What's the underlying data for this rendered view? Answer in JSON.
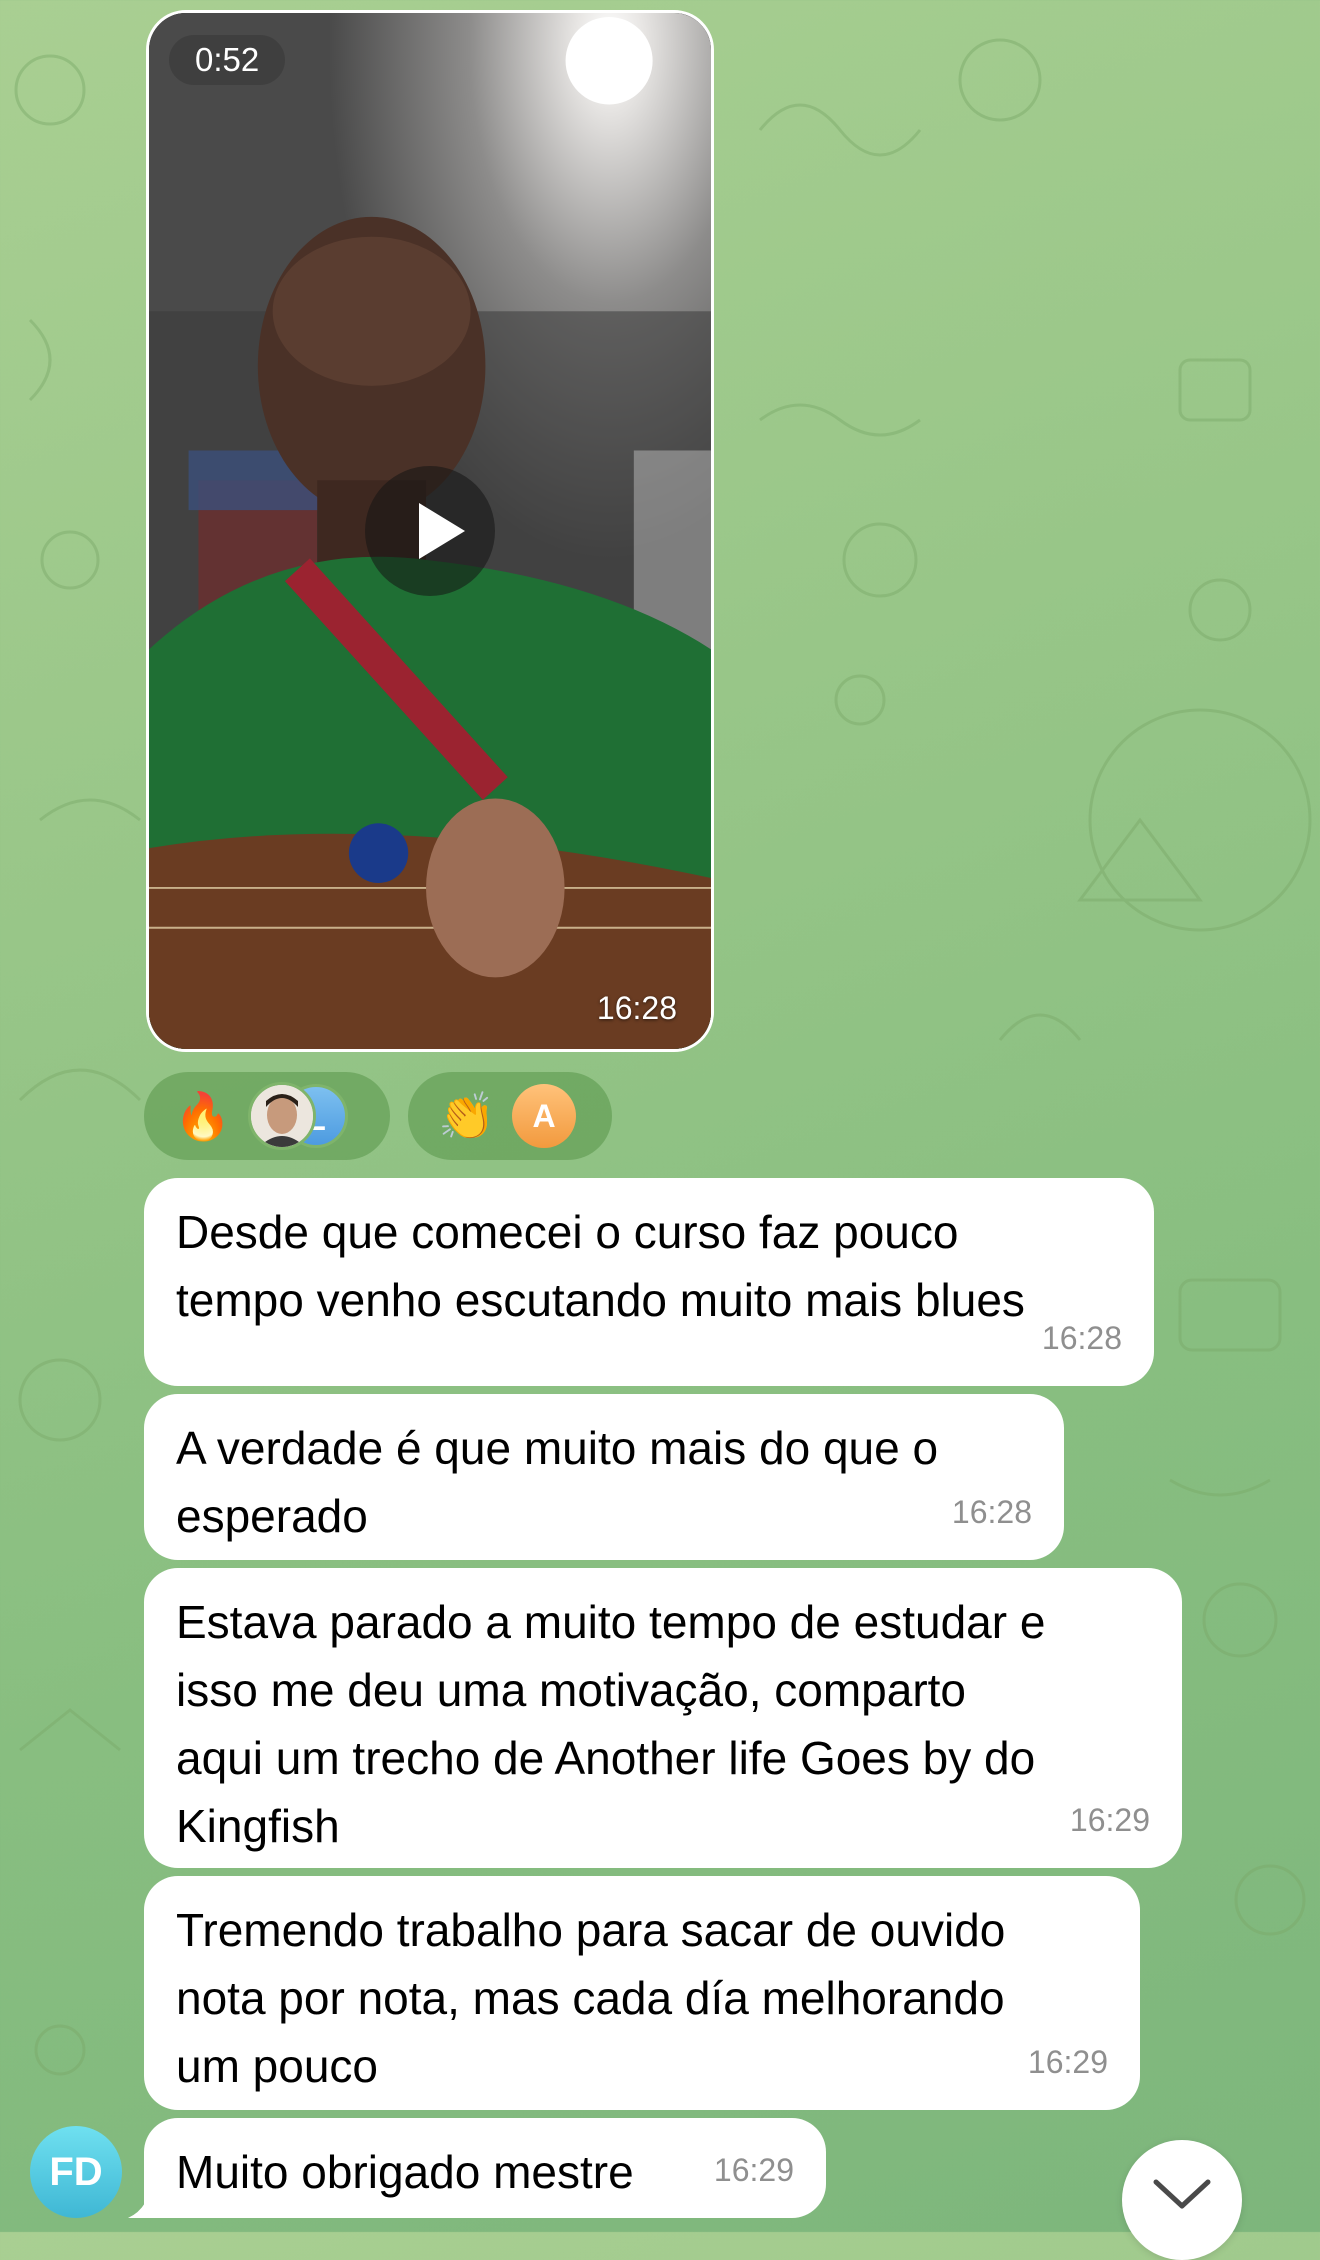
{
  "video": {
    "duration": "0:52",
    "time": "16:28",
    "icons": {
      "play": "play-icon"
    }
  },
  "reactions": [
    {
      "emoji": "🔥",
      "avatars": [
        "photo",
        "L"
      ]
    },
    {
      "emoji": "👏",
      "avatars": [
        "A"
      ]
    }
  ],
  "messages": [
    {
      "text": "Desde que comecei o curso faz pouco\ntempo venho escutando muito mais blues",
      "time": "16:28"
    },
    {
      "text": "A verdade é que muito mais do que o\nesperado",
      "time": "16:28"
    },
    {
      "text": "Estava parado a muito tempo de estudar e\nisso me deu uma motivação, comparto\naqui um trecho de Another life Goes by do\nKingfish",
      "time": "16:29"
    },
    {
      "text": "Tremendo trabalho para sacar de ouvido\nnota por nota, mas cada día melhorando\num pouco",
      "time": "16:29"
    },
    {
      "text": "Muito obrigado mestre",
      "time": "16:29"
    }
  ],
  "sender": {
    "initials": "FD"
  },
  "colors": {
    "bubble": "#ffffff",
    "time": "#8f8f8f",
    "wallpaper": "#98c688"
  }
}
